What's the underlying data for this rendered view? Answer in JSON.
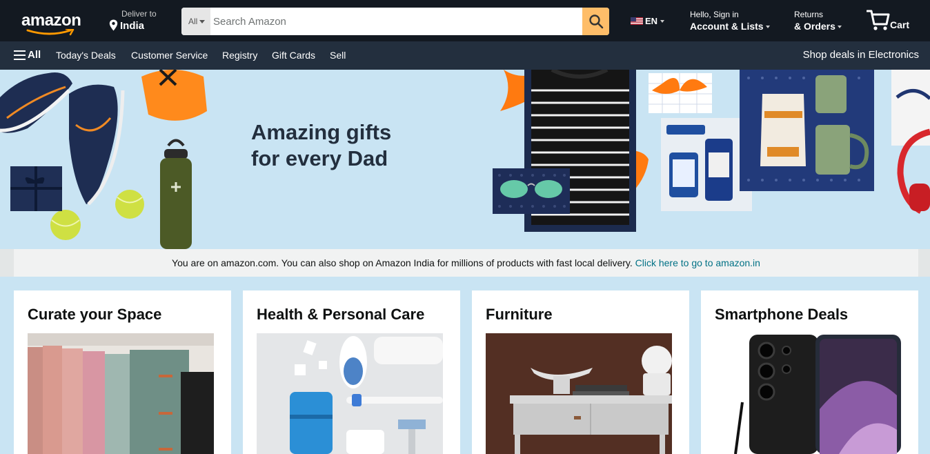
{
  "header": {
    "logo_text": "amazon",
    "deliver_label": "Deliver to",
    "deliver_location": "India",
    "search": {
      "category": "All",
      "placeholder": "Search Amazon",
      "value": ""
    },
    "language": "EN",
    "account_greeting": "Hello, Sign in",
    "account_label": "Account & Lists",
    "returns_label": "Returns",
    "orders_label": "& Orders",
    "cart_label": "Cart"
  },
  "subnav": {
    "all_label": "All",
    "links": [
      "Today's Deals",
      "Customer Service",
      "Registry",
      "Gift Cards",
      "Sell"
    ],
    "promo": "Shop deals in Electronics"
  },
  "hero": {
    "headline_line1": "Amazing gifts",
    "headline_line2": "for every Dad"
  },
  "notice": {
    "text": "You are on amazon.com. You can also shop on Amazon India for millions of products with fast local delivery.",
    "link": "Click here to go to amazon.in"
  },
  "cards": [
    {
      "title": "Curate your Space"
    },
    {
      "title": "Health & Personal Care"
    },
    {
      "title": "Furniture"
    },
    {
      "title": "Smartphone Deals"
    }
  ],
  "colors": {
    "nav_dark": "#131921",
    "nav_sub": "#232f3e",
    "search_button": "#febd69",
    "accent_orange": "#ff9900",
    "link_teal": "#007185",
    "hero_bg": "#c9e4f3"
  },
  "icons": [
    "location-pin-icon",
    "search-icon",
    "us-flag-icon",
    "cart-icon",
    "hamburger-icon"
  ]
}
